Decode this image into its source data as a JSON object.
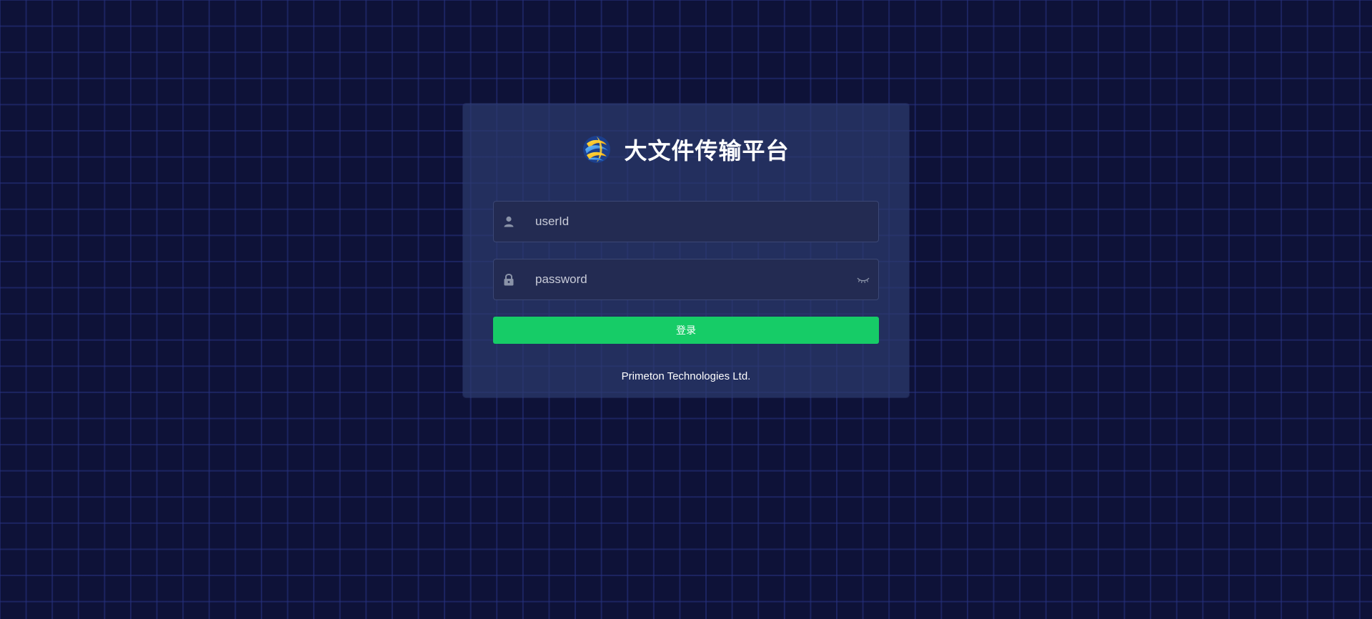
{
  "app": {
    "title": "大文件传输平台",
    "logo_icon": "swirl-globe-logo"
  },
  "login_form": {
    "user_field": {
      "icon": "user-icon",
      "value": "",
      "placeholder": "userId"
    },
    "password_field": {
      "icon": "lock-icon",
      "value": "",
      "placeholder": "password",
      "toggle_icon": "eye-closed-icon"
    },
    "submit_label": "登录"
  },
  "footer": {
    "company": "Primeton Technologies Ltd."
  },
  "colors": {
    "background": "#0e1238",
    "grid_line": "#283282",
    "card": "#2c3a6e",
    "input_bg": "#232b52",
    "input_border": "#3b4775",
    "accent_button": "#16cc67",
    "text": "#ffffff",
    "placeholder": "#c8cbd8",
    "icon": "#8a93a8"
  }
}
